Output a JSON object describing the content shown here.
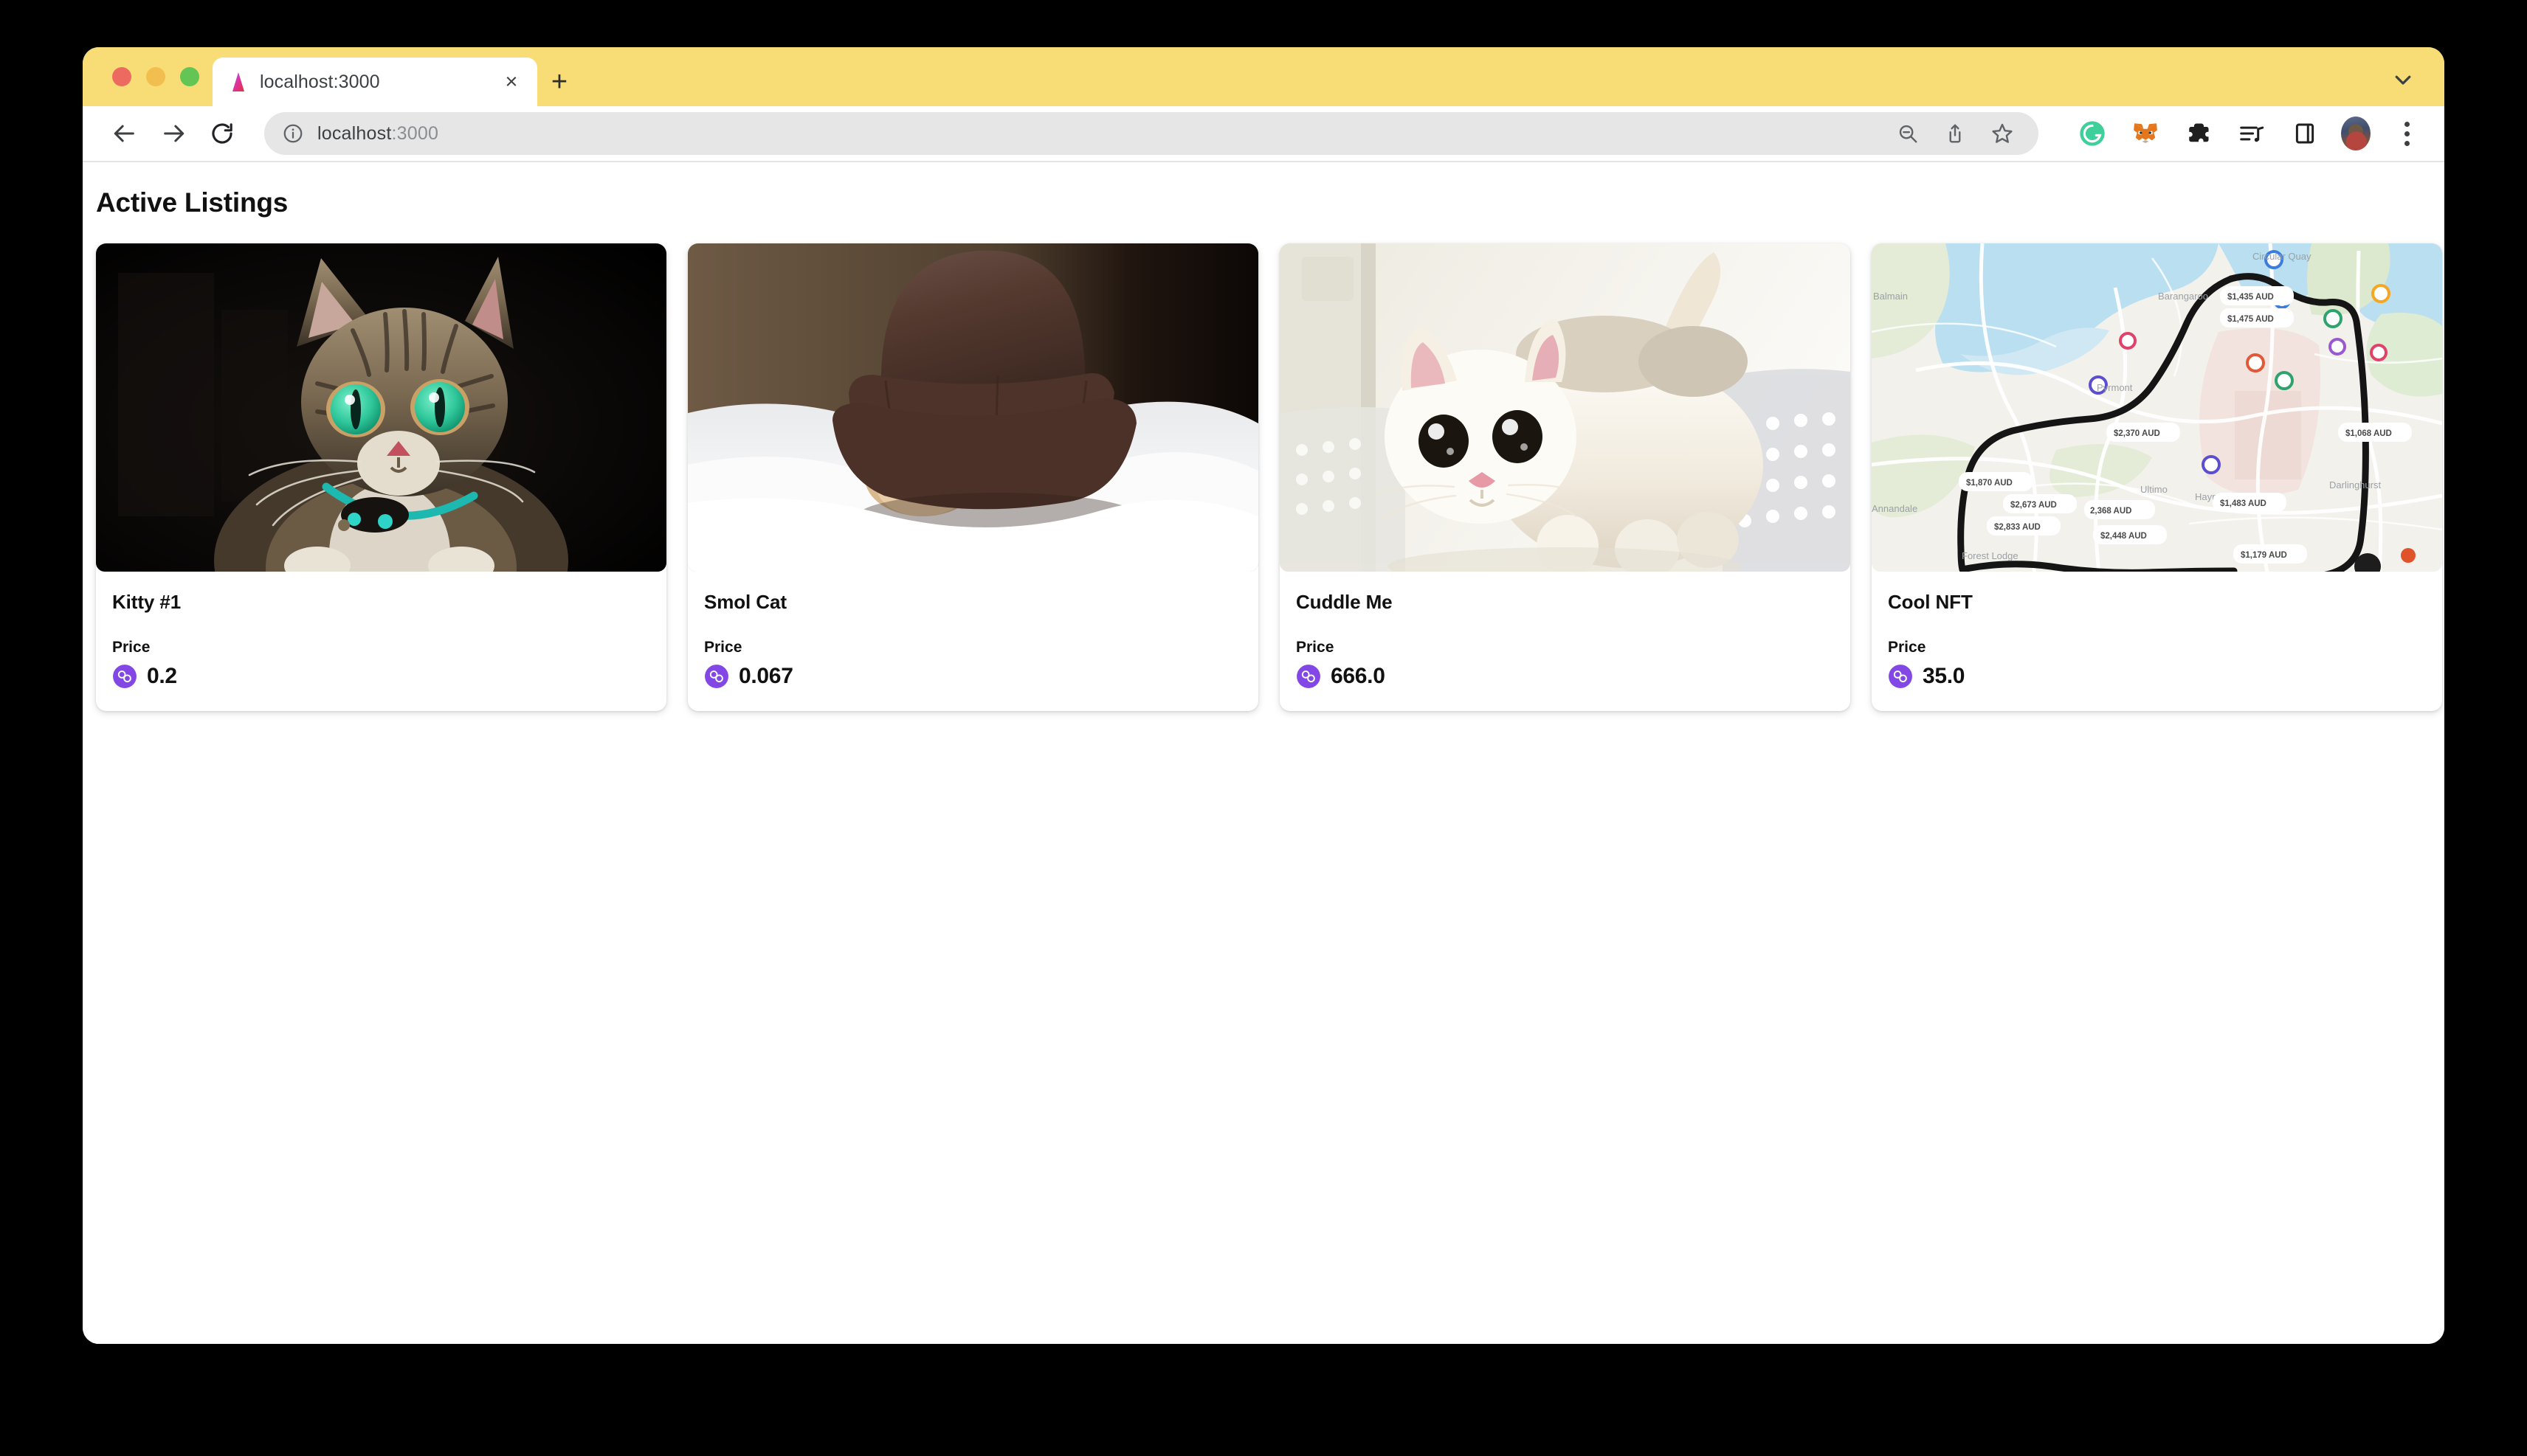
{
  "window": {
    "traffic_lights": [
      "close",
      "minimize",
      "maximize"
    ],
    "tab": {
      "title": "localhost:3000",
      "favicon": "nextjs-triangle-icon",
      "close_label": "×"
    },
    "new_tab_label": "+",
    "tab_search_icon": "chevron-down-icon"
  },
  "toolbar": {
    "back_icon": "arrow-left-icon",
    "forward_icon": "arrow-right-icon",
    "reload_icon": "reload-icon",
    "site_info_icon": "info-circle-icon",
    "url_host": "localhost",
    "url_port": ":3000",
    "url_full": "localhost:3000",
    "zoom_out_icon": "zoom-out-icon",
    "share_icon": "share-icon",
    "bookmark_icon": "star-icon",
    "extensions": [
      {
        "name": "grammarly-extension-icon",
        "color": "#15c39a"
      },
      {
        "name": "metamask-extension-icon",
        "color": "#e2761b"
      },
      {
        "name": "extensions-puzzle-icon",
        "color": "#1f1f1f"
      },
      {
        "name": "media-playlist-icon",
        "color": "#1f1f1f"
      },
      {
        "name": "side-panel-icon",
        "color": "#1f1f1f"
      }
    ],
    "profile_avatar": "profile-avatar",
    "menu_icon": "three-dot-menu-icon"
  },
  "page": {
    "title": "Active Listings",
    "price_label": "Price",
    "token_icon": "polygon-token-icon",
    "token_color": "#8247e5",
    "listings": [
      {
        "name": "Kitty #1",
        "price": "0.2",
        "image_alt": "tabby-cat-green-eyes-photo"
      },
      {
        "name": "Smol Cat",
        "price": "0.067",
        "image_alt": "kitten-under-brown-hat-photo"
      },
      {
        "name": "Cuddle Me",
        "price": "666.0",
        "image_alt": "white-kitten-in-basket-photo"
      },
      {
        "name": "Cool NFT",
        "price": "35.0",
        "image_alt": "sydney-map-with-price-pins-screenshot"
      }
    ]
  },
  "map_artwork": {
    "places": [
      "Balmain",
      "Barangaroo",
      "Pyrmont",
      "Ultimo",
      "Darlinghurst",
      "Annandale",
      "Forest Lodge",
      "Circular Quay"
    ],
    "price_pills": [
      "$1,435 AUD",
      "$1,475 AUD",
      "$2,370 AUD",
      "$1,068 AUD",
      "$1,870 AUD",
      "$2,673 AUD",
      "$2,368 AUD",
      "$2,833 AUD",
      "$2,448 AUD",
      "$1,483 AUD",
      "$1,179 AUD"
    ]
  }
}
